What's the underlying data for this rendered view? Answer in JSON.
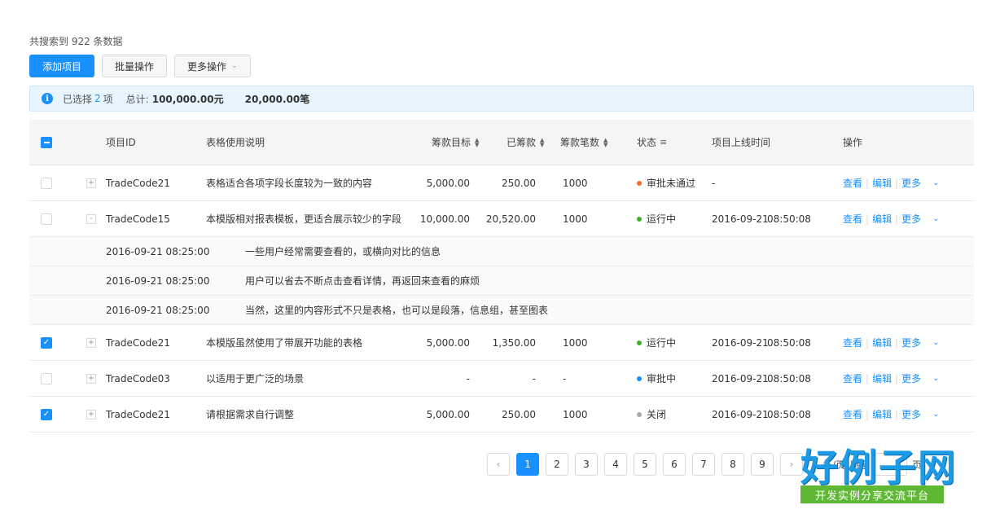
{
  "summary": "共搜索到 922 条数据",
  "toolbar": {
    "add_label": "添加项目",
    "batch_label": "批量操作",
    "more_label": "更多操作"
  },
  "info": {
    "selected_prefix": "已选择",
    "selected_count": "2",
    "selected_suffix": "项",
    "total_label": "总计:",
    "total_amount": "100,000.00元",
    "total_count": "20,000.00笔"
  },
  "table": {
    "headers": {
      "id": "项目ID",
      "desc": "表格使用说明",
      "target": "筹款目标",
      "raised": "已筹款",
      "count": "筹款笔数",
      "status": "状态",
      "online": "项目上线时间",
      "ops": "操作"
    },
    "rows": [
      {
        "checked": false,
        "expand": "+",
        "id": "TradeCode21",
        "desc": "表格适合各项字段长度较为一致的内容",
        "target": "5,000.00",
        "raised": "250.00",
        "count": "1000",
        "status": "审批未通过",
        "status_color": "#f56c2d",
        "date": "-",
        "time": "",
        "op_view": "查看",
        "op_edit": "编辑",
        "op_more": "更多"
      },
      {
        "checked": false,
        "expand": "-",
        "id": "TradeCode15",
        "desc": "本模版相对报表模板，更适合展示较少的字段",
        "target": "10,000.00",
        "raised": "20,520.00",
        "count": "1000",
        "status": "运行中",
        "status_color": "#3fae29",
        "date": "2016-09-21",
        "time": "08:50:08",
        "op_view": "查看",
        "op_edit": "编辑",
        "op_more": "更多"
      },
      {
        "checked": true,
        "expand": "+",
        "id": "TradeCode21",
        "desc": "本模版虽然使用了带展开功能的表格",
        "target": "5,000.00",
        "raised": "1,350.00",
        "count": "1000",
        "status": "运行中",
        "status_color": "#3fae29",
        "date": "2016-09-21",
        "time": "08:50:08",
        "op_view": "查看",
        "op_edit": "编辑",
        "op_more": "更多"
      },
      {
        "checked": false,
        "expand": "+",
        "id": "TradeCode03",
        "desc": "以适用于更广泛的场景",
        "target": "-",
        "raised": "-",
        "count": "-",
        "status": "审批中",
        "status_color": "#1890ff",
        "date": "2016-09-21",
        "time": "08:50:08",
        "op_view": "查看",
        "op_edit": "编辑",
        "op_more": "更多"
      },
      {
        "checked": true,
        "expand": "+",
        "id": "TradeCode21",
        "desc": "请根据需求自行调整",
        "target": "5,000.00",
        "raised": "250.00",
        "count": "1000",
        "status": "关闭",
        "status_color": "#aaaaaa",
        "date": "2016-09-21",
        "time": "08:50:08",
        "op_view": "查看",
        "op_edit": "编辑",
        "op_more": "更多"
      }
    ],
    "sub_rows": [
      {
        "time": "2016-09-21 08:25:00",
        "text": "一些用户经常需要查看的，或横向对比的信息"
      },
      {
        "time": "2016-09-21 08:25:00",
        "text": "用户可以省去不断点击查看详情，再返回来查看的麻烦"
      },
      {
        "time": "2016-09-21 08:25:00",
        "text": "当然，这里的内容形式不只是表格，也可以是段落，信息组，甚至图表"
      }
    ]
  },
  "pagination": {
    "pages": [
      "1",
      "2",
      "3",
      "4",
      "5",
      "6",
      "7",
      "8",
      "9"
    ],
    "current": "1",
    "tail_prefix": "条/页",
    "jump_label": "跳至",
    "jump_suffix": "页"
  },
  "watermark": {
    "brand": "好例子网",
    "slogan": "开发实例分享交流平台"
  }
}
